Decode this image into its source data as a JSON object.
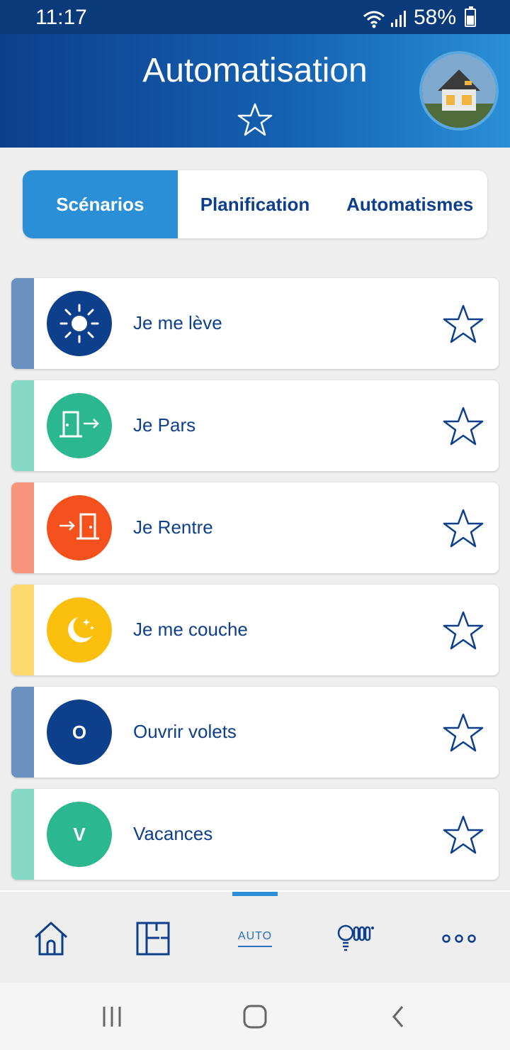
{
  "status_bar": {
    "time": "11:17",
    "battery": "58%"
  },
  "header": {
    "title": "Automatisation"
  },
  "tabs": [
    {
      "label": "Scénarios",
      "active": true
    },
    {
      "label": "Planification",
      "active": false
    },
    {
      "label": "Automatismes",
      "active": false
    }
  ],
  "scenarios": [
    {
      "label": "Je me lève",
      "icon": "sun-icon",
      "icon_color": "#0d3f8c",
      "stripe_color": "#6b8fbf"
    },
    {
      "label": "Je Pars",
      "icon": "door-exit-icon",
      "icon_color": "#2bb78f",
      "stripe_color": "#85d8c4"
    },
    {
      "label": "Je Rentre",
      "icon": "door-enter-icon",
      "icon_color": "#f4511e",
      "stripe_color": "#f7967c"
    },
    {
      "label": "Je me couche",
      "icon": "moon-icon",
      "icon_color": "#fbbf0e",
      "stripe_color": "#fcd86e"
    },
    {
      "label": "Ouvrir volets",
      "icon_letter": "O",
      "icon_color": "#0d3f8c",
      "stripe_color": "#6b8fbf"
    },
    {
      "label": "Vacances",
      "icon_letter": "V",
      "icon_color": "#2bb78f",
      "stripe_color": "#85d8c4"
    }
  ],
  "bottom_nav": {
    "auto_label": "AUTO",
    "items": [
      "home-icon",
      "floorplan-icon",
      "auto-icon",
      "devices-icon",
      "more-icon"
    ]
  },
  "colors": {
    "primary": "#0d3f8c",
    "accent": "#2a8fd6"
  }
}
